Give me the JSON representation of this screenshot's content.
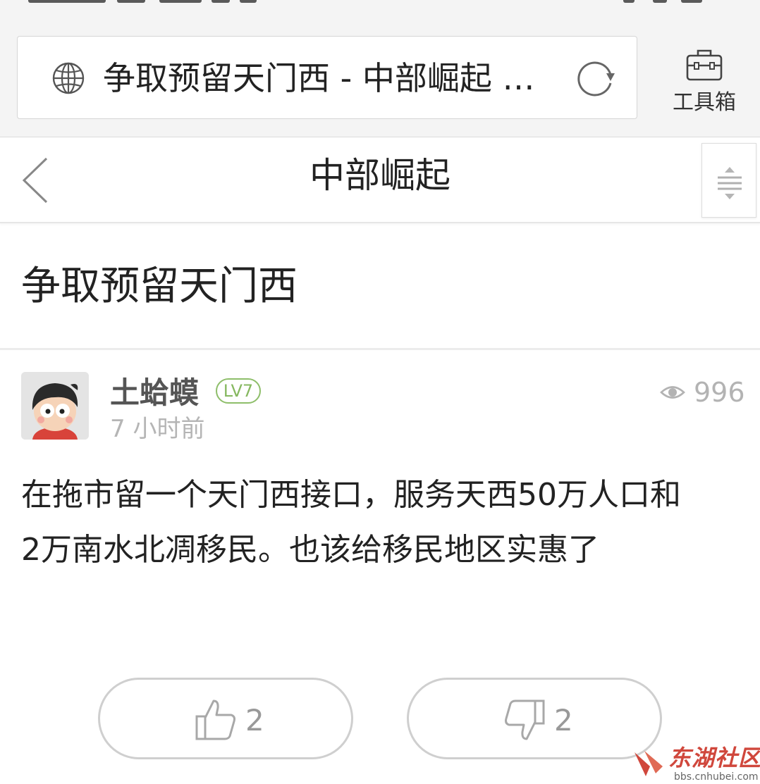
{
  "browser": {
    "url_title": "争取预留天门西 - 中部崛起 …",
    "toolbox_label": "工具箱"
  },
  "header": {
    "forum_name": "中部崛起"
  },
  "thread": {
    "title": "争取预留天门西"
  },
  "post": {
    "author": "土蛤蟆",
    "level": "LV7",
    "time": "7 小时前",
    "views": "996",
    "body_lines": [
      "在拖市留一个天门西接口，服务天西50万人口和",
      "2万南水北凋移民。也该给移民地区实惠了"
    ]
  },
  "votes": {
    "up_count": "2",
    "down_count": "2"
  },
  "watermark": {
    "name": "东湖社区",
    "url": "bbs.cnhubei.com"
  },
  "colors": {
    "level_badge": "#86b860",
    "watermark_red": "#d0473c",
    "muted_text": "#b3b3b3"
  },
  "icons": [
    "globe-icon",
    "reload-icon",
    "toolbox-icon",
    "back-icon",
    "scroll-handle-icon",
    "eye-icon",
    "thumbs-up-icon",
    "thumbs-down-icon"
  ]
}
